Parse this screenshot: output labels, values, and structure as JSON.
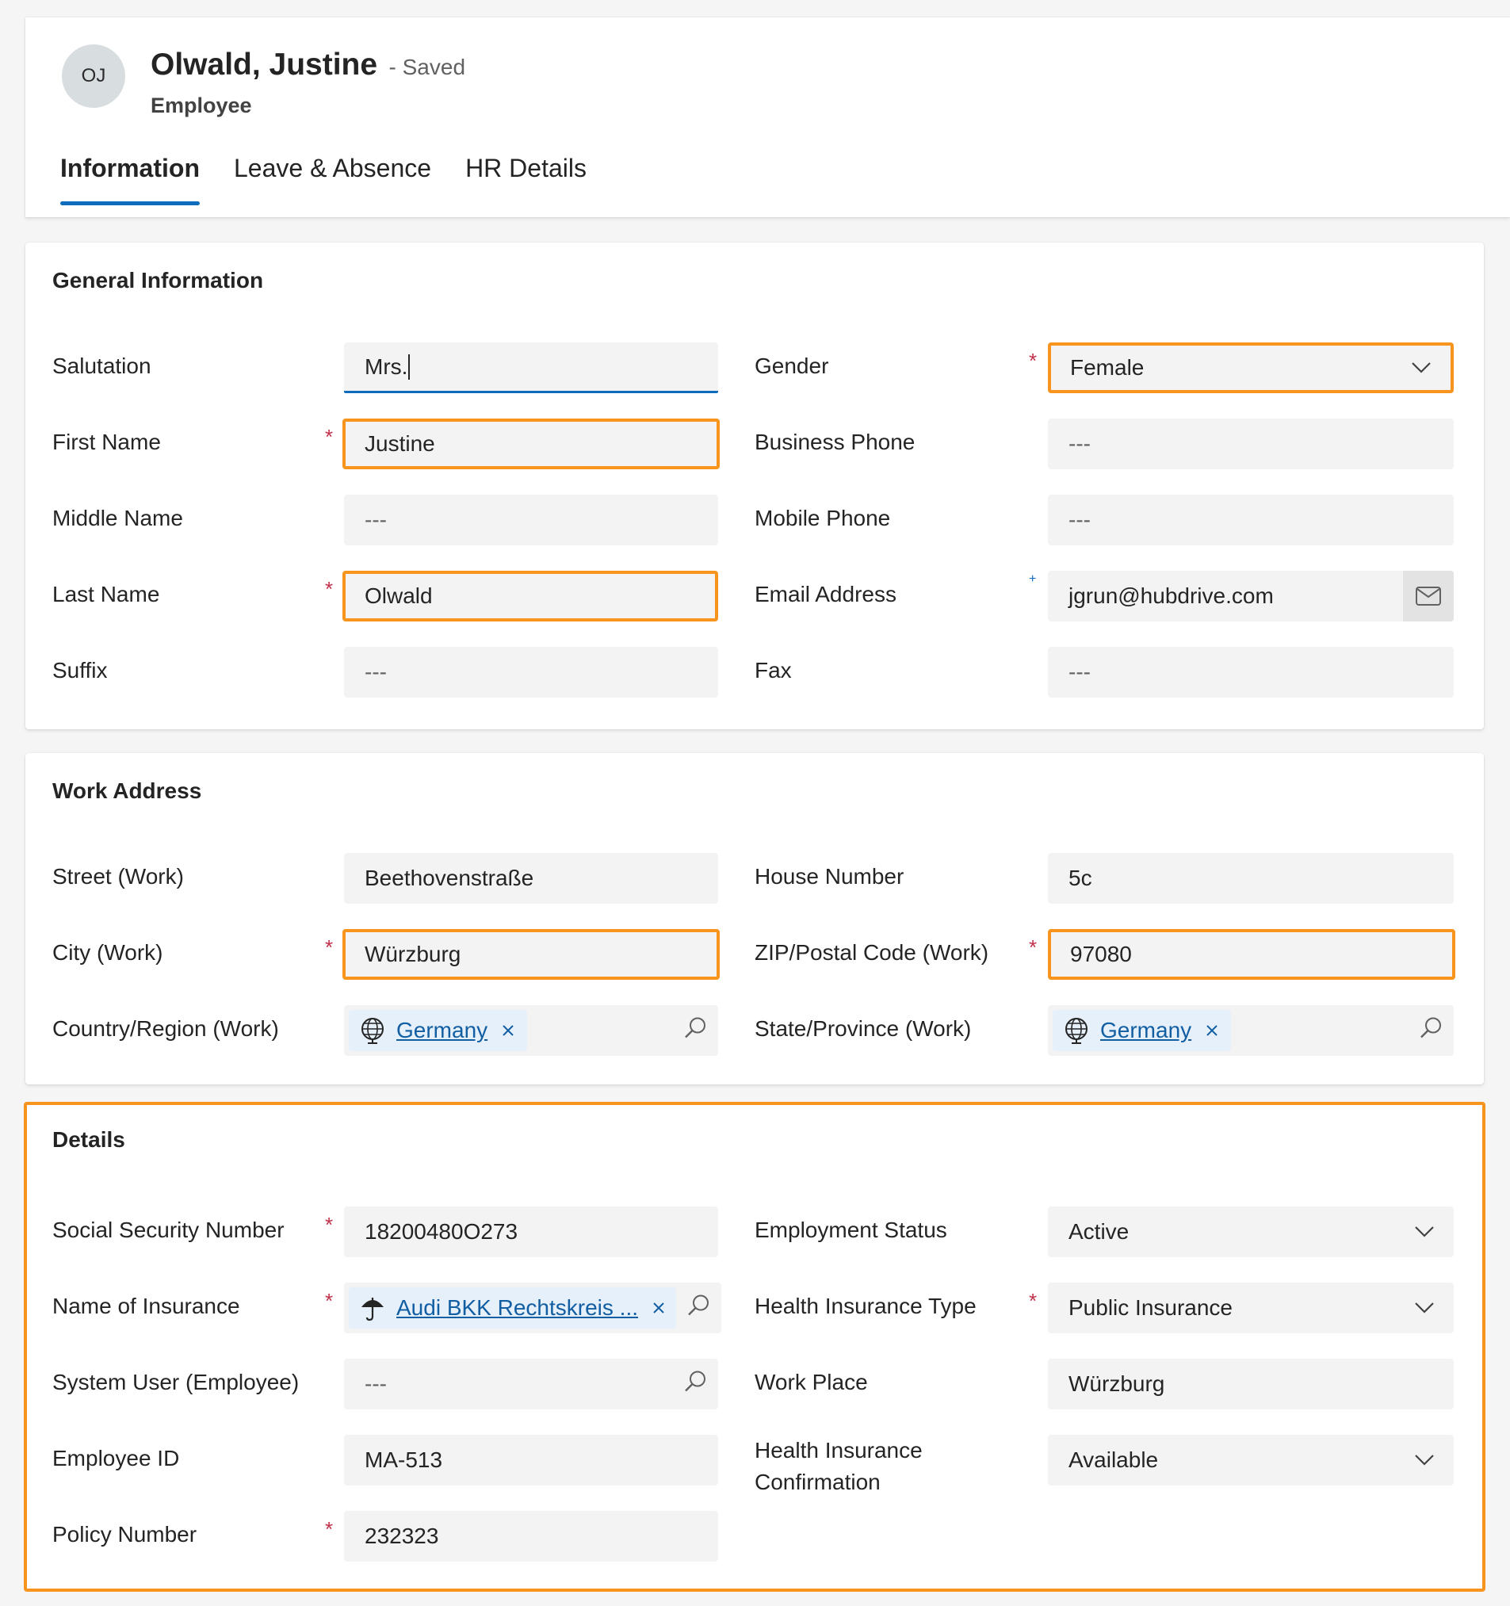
{
  "record": {
    "initials": "OJ",
    "title": "Olwald, Justine",
    "status": "- Saved",
    "entity": "Employee"
  },
  "tabs": [
    {
      "label": "Information",
      "active": true
    },
    {
      "label": "Leave & Absence",
      "active": false
    },
    {
      "label": "HR Details",
      "active": false
    }
  ],
  "general": {
    "title": "General Information",
    "salutation": {
      "label": "Salutation",
      "value": "Mrs."
    },
    "first_name": {
      "label": "First Name",
      "value": "Justine"
    },
    "middle_name": {
      "label": "Middle Name",
      "value": "---"
    },
    "last_name": {
      "label": "Last Name",
      "value": "Olwald"
    },
    "suffix": {
      "label": "Suffix",
      "value": "---"
    },
    "gender": {
      "label": "Gender",
      "value": "Female"
    },
    "business_phone": {
      "label": "Business Phone",
      "value": "---"
    },
    "mobile_phone": {
      "label": "Mobile Phone",
      "value": "---"
    },
    "email": {
      "label": "Email Address",
      "value": "jgrun@hubdrive.com"
    },
    "fax": {
      "label": "Fax",
      "value": "---"
    }
  },
  "work_address": {
    "title": "Work Address",
    "street": {
      "label": "Street (Work)",
      "value": "Beethovenstraße"
    },
    "city": {
      "label": "City (Work)",
      "value": "Würzburg"
    },
    "country": {
      "label": "Country/Region (Work)",
      "value": "Germany"
    },
    "house_number": {
      "label": "House Number",
      "value": "5c"
    },
    "zip": {
      "label": "ZIP/Postal Code (Work)",
      "value": "97080"
    },
    "state": {
      "label": "State/Province (Work)",
      "value": "Germany"
    }
  },
  "details": {
    "title": "Details",
    "ssn": {
      "label": "Social Security Number",
      "value": "18200480O273"
    },
    "insurance_name": {
      "label": "Name of Insurance",
      "value": "Audi BKK Rechtskreis ..."
    },
    "system_user": {
      "label": "System User (Employee)",
      "value": "---"
    },
    "employee_id": {
      "label": "Employee ID",
      "value": "MA-513"
    },
    "policy_number": {
      "label": "Policy Number",
      "value": "232323"
    },
    "employment_status": {
      "label": "Employment Status",
      "value": "Active"
    },
    "health_insurance_type": {
      "label": "Health Insurance Type",
      "value": "Public Insurance"
    },
    "work_place": {
      "label": "Work Place",
      "value": "Würzburg"
    },
    "hic_line1": "Health Insurance",
    "hic_line2": "Confirmation",
    "hic_value": "Available"
  },
  "required_mark": "*",
  "recommended_mark": "+",
  "colors": {
    "accent": "#0f6cbd",
    "highlight": "#f7941d",
    "required": "#c4314b",
    "link": "#115ea3"
  },
  "icons": [
    "chevron-down-icon",
    "mail-icon",
    "globe-icon",
    "close-icon",
    "search-icon",
    "umbrella-icon"
  ]
}
